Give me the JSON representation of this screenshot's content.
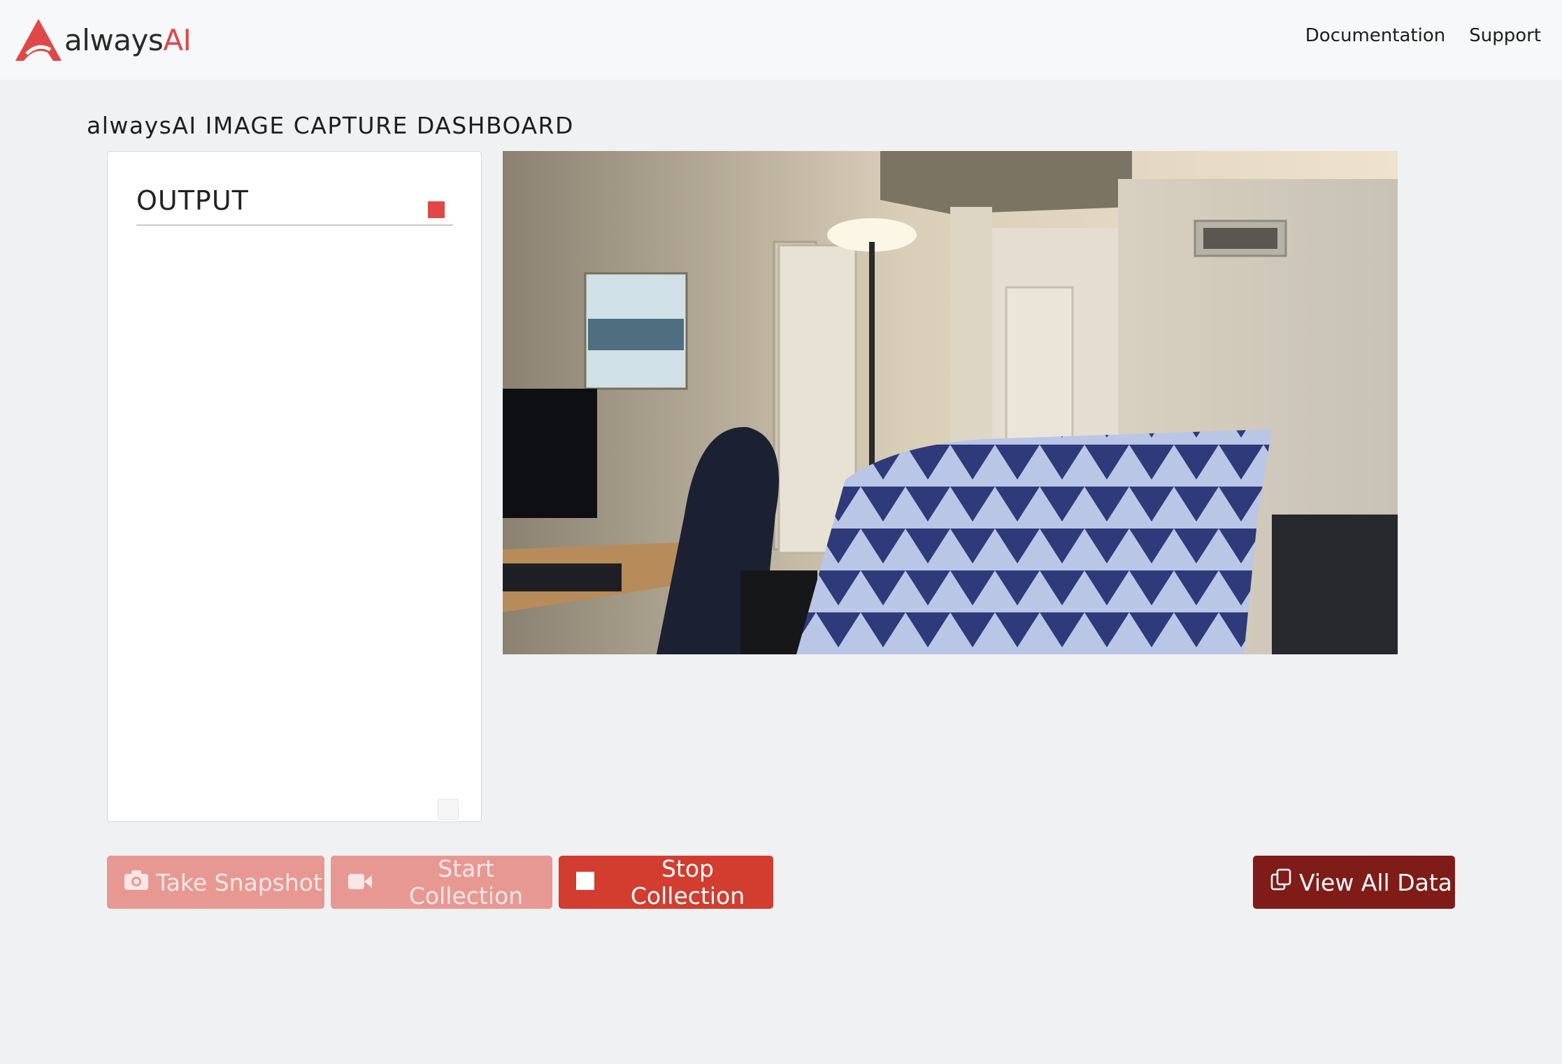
{
  "nav": {
    "brand_always": "always",
    "brand_ai": "AI",
    "links": [
      "Documentation",
      "Support"
    ]
  },
  "page": {
    "title": "alwaysAI IMAGE CAPTURE DASHBOARD"
  },
  "output": {
    "title": "OUTPUT",
    "status": "recording",
    "log": ""
  },
  "buttons": {
    "snapshot": "Take Snapshot",
    "start": "Start Collection",
    "stop": "Stop Collection",
    "view": "View All Data"
  },
  "icons": {
    "snapshot": "camera-icon",
    "start": "video-camera-icon",
    "stop": "stop-square-icon",
    "view": "copy-icon"
  },
  "colors": {
    "brand_red": "#e04848",
    "disabled_button": "#e89893",
    "stop_button": "#d23d30",
    "view_button": "#801c18"
  }
}
